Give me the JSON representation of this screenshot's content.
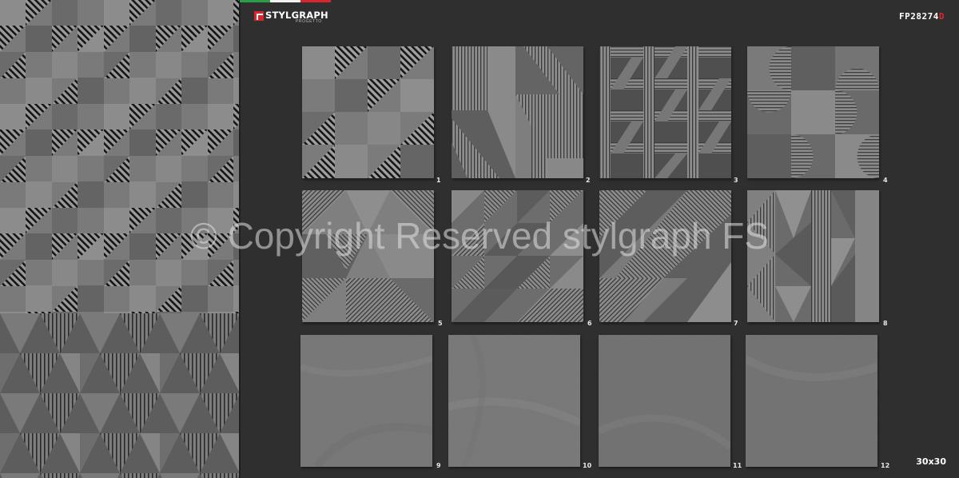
{
  "brand": {
    "name": "STYLGRAPH",
    "subtitle": "PROGETTO"
  },
  "product": {
    "code_main": "FP28274",
    "code_suffix": "D",
    "size": "30x30"
  },
  "watermark": "© Copyright Reserved stylgraph FS",
  "tiles": [
    {
      "number": "1",
      "pattern": "diagonal-steps"
    },
    {
      "number": "2",
      "pattern": "vertical-stripes-diagonal"
    },
    {
      "number": "3",
      "pattern": "lattice-weave"
    },
    {
      "number": "4",
      "pattern": "half-circles"
    },
    {
      "number": "5",
      "pattern": "triangles-stripes"
    },
    {
      "number": "6",
      "pattern": "diamond-diagonal"
    },
    {
      "number": "7",
      "pattern": "chevron-diagonal"
    },
    {
      "number": "8",
      "pattern": "vertical-triangles"
    },
    {
      "number": "9",
      "pattern": "plain-stone"
    },
    {
      "number": "10",
      "pattern": "plain-stone"
    },
    {
      "number": "11",
      "pattern": "plain-stone"
    },
    {
      "number": "12",
      "pattern": "plain-stone"
    }
  ],
  "colors": {
    "background": "#2f2f2f",
    "stone_light": "#8a8a8a",
    "stone_mid": "#6e6e6e",
    "stone_dark": "#505050",
    "stripe": "#1c1c1c",
    "brand_red": "#d7262d",
    "flag_green": "#2a9d48",
    "flag_white": "#f2f2f2",
    "flag_red": "#d7262d"
  }
}
